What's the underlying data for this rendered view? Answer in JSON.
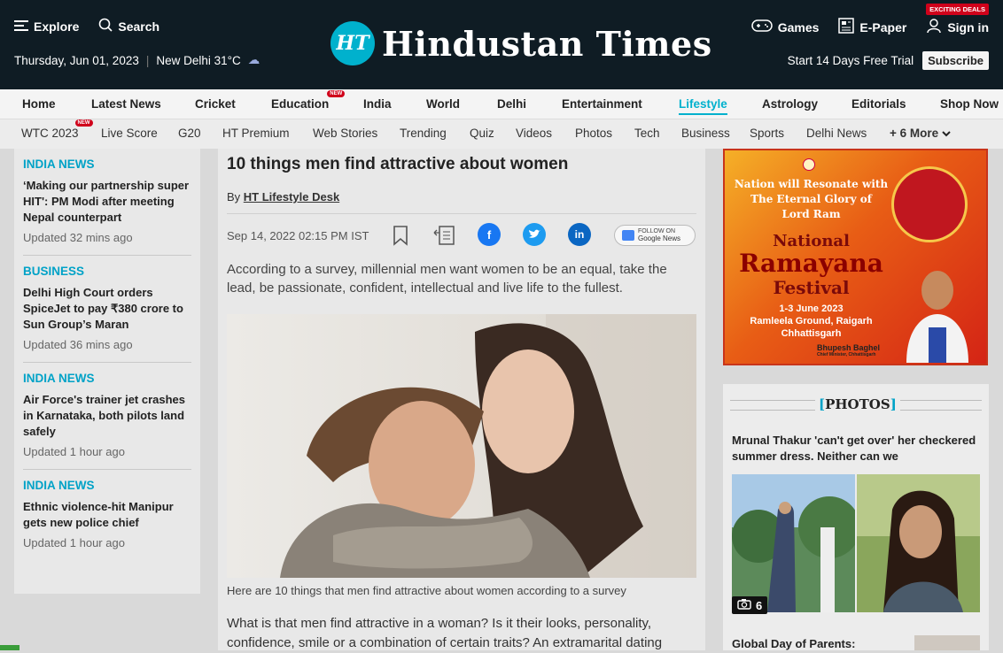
{
  "header": {
    "explore": "Explore",
    "search": "Search",
    "date": "Thursday, Jun 01, 2023",
    "weather": "New Delhi 31°C",
    "logo_badge": "HT",
    "logo_text": "Hindustan Times",
    "games": "Games",
    "epaper": "E-Paper",
    "signin": "Sign in",
    "deals": "EXCITING DEALS",
    "trial": "Start 14 Days Free Trial",
    "subscribe": "Subscribe"
  },
  "nav1": [
    "Home",
    "Latest News",
    "Cricket",
    "Education",
    "India",
    "World",
    "Delhi",
    "Entertainment",
    "Lifestyle",
    "Astrology",
    "Editorials",
    "Shop Now"
  ],
  "nav1_new": "NEW",
  "nav2": [
    "WTC 2023",
    "Live Score",
    "G20",
    "HT Premium",
    "Web Stories",
    "Trending",
    "Quiz",
    "Videos",
    "Photos",
    "Tech",
    "Business",
    "Sports",
    "Delhi News",
    "+ 6 More"
  ],
  "sidebar": [
    {
      "category": "INDIA NEWS",
      "title": "‘Making our partnership super HIT': PM Modi after meeting Nepal counterpart",
      "updated": "Updated 32 mins ago"
    },
    {
      "category": "BUSINESS",
      "title": "Delhi High Court orders SpiceJet to pay ₹380 crore to Sun Group’s Maran",
      "updated": "Updated 36 mins ago"
    },
    {
      "category": "INDIA NEWS",
      "title": "Air Force's trainer jet crashes in Karnataka, both pilots land safely",
      "updated": "Updated 1 hour ago"
    },
    {
      "category": "INDIA NEWS",
      "title": "Ethnic violence-hit Manipur gets new police chief",
      "updated": "Updated 1 hour ago"
    }
  ],
  "article": {
    "title": "10 things men find attractive about women",
    "by": "By",
    "author": "HT Lifestyle Desk",
    "date": "Sep 14, 2022 02:15 PM IST",
    "gnews_small": "FOLLOW ON",
    "gnews": "Google News",
    "lead": "According to a survey, millennial men want women to be an equal, take the lead, be passionate, confident, intellectual and live life to the fullest.",
    "caption": "Here are 10 things that men find attractive about women according to a survey",
    "body": "What is that men find attractive in a woman? Is it their looks, personality, confidence, smile or a combination of certain traits? An extramarital dating"
  },
  "ad": {
    "line1": "Nation will Resonate with",
    "line2": "The Eternal Glory of",
    "line3": "Lord Ram",
    "national": "National",
    "ramayana": "Ramayana",
    "festival": "Festival",
    "dates": "1-3 June 2023",
    "venue1": "Ramleela Ground, Raigarh",
    "venue2": "Chhattisgarh",
    "person": "Bhupesh Baghel",
    "person_role": "Chief Minister, Chhattisgarh"
  },
  "photos": {
    "label": "PHOTOS",
    "title": "Mrunal Thakur 'can't get over' her checkered summer dress. Neither can we",
    "count": "6",
    "next_title": "Global Day of Parents:"
  }
}
